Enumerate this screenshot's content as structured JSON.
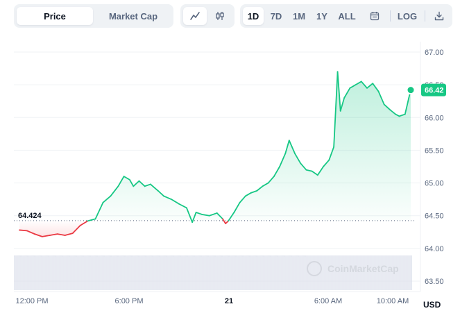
{
  "toolbar": {
    "metric_tabs": [
      {
        "label": "Price",
        "active": true
      },
      {
        "label": "Market Cap",
        "active": false
      }
    ],
    "chart_type_icons": [
      "line-chart-icon",
      "candlestick-icon"
    ],
    "ranges": [
      {
        "label": "1D",
        "active": true
      },
      {
        "label": "7D",
        "active": false
      },
      {
        "label": "1M",
        "active": false
      },
      {
        "label": "1Y",
        "active": false
      },
      {
        "label": "ALL",
        "active": false
      }
    ],
    "calendar_icon": "calendar-icon",
    "log_label": "LOG",
    "download_icon": "download-icon"
  },
  "chart_data": {
    "type": "line",
    "x_ticks": [
      "12:00 PM",
      "6:00 PM",
      "21",
      "6:00 AM",
      "10:00 AM"
    ],
    "y_ticks": [
      "67.00",
      "66.50",
      "66.00",
      "65.50",
      "65.00",
      "64.50",
      "64.00",
      "63.50"
    ],
    "ylim": [
      63.5,
      67.0
    ],
    "currency": "USD",
    "reference_value": 64.424,
    "reference_label": "64.424",
    "current_value": 66.42,
    "current_label": "66.42",
    "watermark": "CoinMarketCap",
    "colors": {
      "up": "#16c784",
      "down": "#ea3943",
      "grid": "#eff2f5",
      "volume": "#cfd6e4"
    },
    "series": [
      {
        "values": [
          [
            0,
            64.28
          ],
          [
            0.4,
            64.27
          ],
          [
            0.8,
            64.22
          ],
          [
            1.2,
            64.18
          ],
          [
            1.6,
            64.2
          ],
          [
            2.0,
            64.22
          ],
          [
            2.4,
            64.2
          ],
          [
            2.8,
            64.23
          ],
          [
            3.2,
            64.35
          ],
          [
            3.6,
            64.42
          ],
          [
            4.0,
            64.45
          ],
          [
            4.4,
            64.7
          ],
          [
            4.8,
            64.8
          ],
          [
            5.2,
            64.95
          ],
          [
            5.5,
            65.1
          ],
          [
            5.8,
            65.05
          ],
          [
            6.0,
            64.95
          ],
          [
            6.3,
            65.03
          ],
          [
            6.6,
            64.95
          ],
          [
            6.9,
            64.98
          ],
          [
            7.3,
            64.88
          ],
          [
            7.6,
            64.8
          ],
          [
            8.0,
            64.75
          ],
          [
            8.4,
            64.68
          ],
          [
            8.8,
            64.62
          ],
          [
            9.1,
            64.4
          ],
          [
            9.3,
            64.55
          ],
          [
            9.6,
            64.52
          ],
          [
            10.0,
            64.5
          ],
          [
            10.4,
            64.54
          ],
          [
            10.7,
            64.45
          ],
          [
            10.85,
            64.38
          ],
          [
            11.0,
            64.42
          ],
          [
            11.3,
            64.55
          ],
          [
            11.6,
            64.7
          ],
          [
            11.9,
            64.8
          ],
          [
            12.2,
            64.85
          ],
          [
            12.5,
            64.88
          ],
          [
            12.8,
            64.95
          ],
          [
            13.1,
            65.0
          ],
          [
            13.4,
            65.1
          ],
          [
            13.7,
            65.25
          ],
          [
            14.0,
            65.45
          ],
          [
            14.2,
            65.65
          ],
          [
            14.5,
            65.45
          ],
          [
            14.8,
            65.3
          ],
          [
            15.1,
            65.2
          ],
          [
            15.4,
            65.18
          ],
          [
            15.7,
            65.12
          ],
          [
            16.0,
            65.25
          ],
          [
            16.3,
            65.35
          ],
          [
            16.55,
            65.55
          ],
          [
            16.75,
            66.7
          ],
          [
            16.9,
            66.1
          ],
          [
            17.1,
            66.3
          ],
          [
            17.4,
            66.45
          ],
          [
            17.7,
            66.5
          ],
          [
            18.0,
            66.55
          ],
          [
            18.3,
            66.45
          ],
          [
            18.6,
            66.52
          ],
          [
            18.9,
            66.4
          ],
          [
            19.2,
            66.2
          ],
          [
            19.5,
            66.12
          ],
          [
            19.8,
            66.05
          ],
          [
            20.0,
            66.02
          ],
          [
            20.3,
            66.05
          ],
          [
            20.5,
            66.3
          ],
          [
            20.6,
            66.42
          ]
        ]
      }
    ],
    "x_range": [
      0,
      20.6
    ]
  }
}
